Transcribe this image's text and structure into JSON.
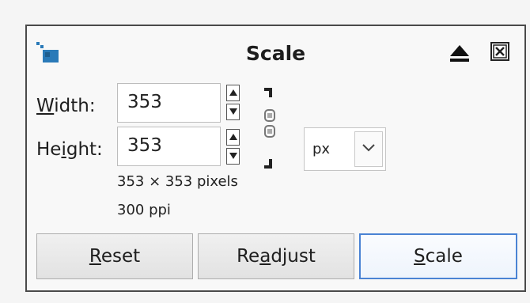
{
  "dialog": {
    "title": "Scale",
    "app_icon": "scale-image-icon",
    "collapse_icon": "eject-icon",
    "close_icon": "close-icon"
  },
  "fields": {
    "width_label": {
      "accel": "W",
      "rest": "idth:"
    },
    "width_value": "353",
    "height_label": {
      "pre": "He",
      "accel": "i",
      "rest": "ght:"
    },
    "height_value": "353",
    "unit": "px",
    "chain_icon": "chain-link-icon"
  },
  "info": {
    "pixels": "353 × 353 pixels",
    "resolution": "300 ppi"
  },
  "buttons": {
    "reset": {
      "accel": "R",
      "rest": "eset"
    },
    "readjust": {
      "pre": "Re",
      "accel": "a",
      "rest": "djust"
    },
    "scale": {
      "accel": "S",
      "rest": "cale"
    }
  },
  "colors": {
    "primary_border": "#4a83d4",
    "icon_blue": "#2a7ab8"
  }
}
